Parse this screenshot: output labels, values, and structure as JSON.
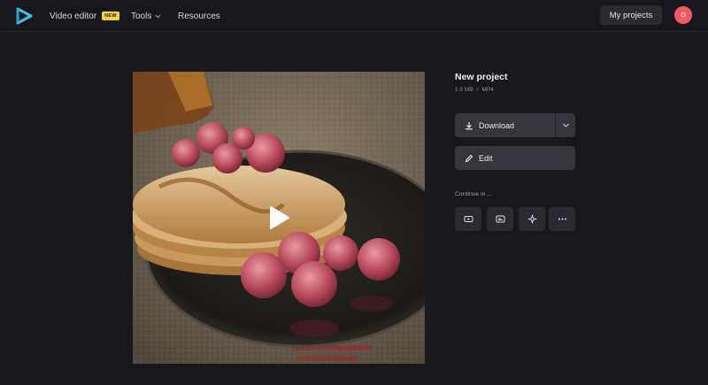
{
  "header": {
    "logo": "clideo-play-logo",
    "nav": {
      "video_editor": "Video editor",
      "new_badge": "NEW",
      "tools": "Tools",
      "resources": "Resources"
    },
    "my_projects": "My projects",
    "avatar_initial": "O"
  },
  "preview": {
    "image": "pancakes-with-raspberries-and-syrup",
    "play_icon": "play-icon"
  },
  "project": {
    "title": "New project",
    "size": "1.9 MB",
    "separator": "/",
    "format": "MP4",
    "download_label": "Download",
    "edit_label": "Edit",
    "continue_label": "Continue in ...",
    "continue_tools": [
      "youtube-icon",
      "subtitles-icon",
      "sparkle-icon",
      "more-icon"
    ]
  },
  "colors": {
    "background": "#18181c",
    "button": "#35353b",
    "badge": "#f5d33e",
    "avatar": "#ef5a64"
  }
}
